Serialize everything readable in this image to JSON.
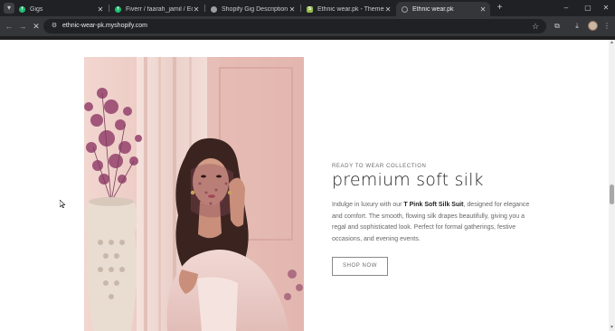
{
  "tabs": [
    {
      "title": "Gigs",
      "favicon": "fiverr-icon",
      "active": false
    },
    {
      "title": "Fiverr / faarah_jamil / Edit Gig",
      "favicon": "fiverr-icon",
      "active": false
    },
    {
      "title": "Shopify Gig Description",
      "favicon": "globe-icon",
      "active": false
    },
    {
      "title": "Ethnic wear.pk - Themes - Shop",
      "favicon": "shopify-icon",
      "active": false
    },
    {
      "title": "Ethnic wear.pk",
      "favicon": "page-icon",
      "active": true
    }
  ],
  "toolbar": {
    "url": "ethnic-wear-pk.myshopify.com"
  },
  "icons": {
    "tab_search": "▾",
    "close": "✕",
    "new_tab": "+",
    "minimize": "–",
    "maximize": "▢",
    "window_close": "✕",
    "back": "←",
    "forward": "→",
    "stop": "✕",
    "site_info": "⚙",
    "star": "☆",
    "extensions": "⧉",
    "download": "⤓",
    "menu": "⋮"
  },
  "section": {
    "eyebrow": "READY TO WEAR COLLECTION",
    "heading": "premium soft silk",
    "desc_before": "Indulge in luxury with our ",
    "desc_bold": "T Pink Soft Silk Suit",
    "desc_after": ", designed for elegance and comfort. The smooth, flowing silk drapes beautifully, giving you a regal and sophisticated look. Perfect for formal gatherings, festive occasions, and evening events.",
    "button": "SHOP NOW"
  },
  "colors": {
    "browser_dark": "#202124",
    "toolbar": "#35363a",
    "page_bg": "#ffffff",
    "heading_text": "#1f1f1f",
    "body_text": "#666666",
    "photo_backdrop": "#e9c6c0"
  }
}
